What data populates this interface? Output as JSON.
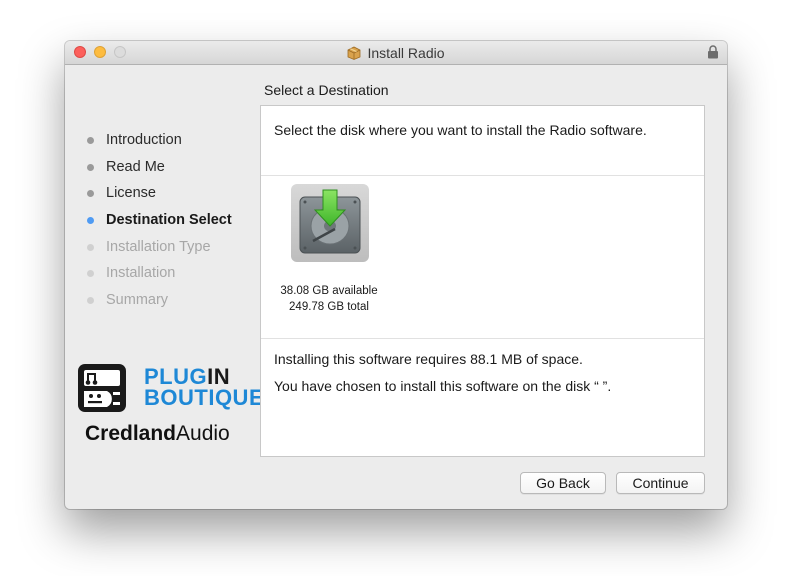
{
  "window": {
    "title": "Install Radio",
    "title_icon": "package-icon",
    "lock_icon": "lock-icon"
  },
  "steps": [
    {
      "label": "Introduction",
      "state": "done"
    },
    {
      "label": "Read Me",
      "state": "done"
    },
    {
      "label": "License",
      "state": "done"
    },
    {
      "label": "Destination Select",
      "state": "active"
    },
    {
      "label": "Installation Type",
      "state": "future"
    },
    {
      "label": "Installation",
      "state": "future"
    },
    {
      "label": "Summary",
      "state": "future"
    }
  ],
  "branding": {
    "plugin_line1_a": "PLUG",
    "plugin_line1_b": "IN",
    "plugin_line2": "BOUTIQUE",
    "credland_bold": "Credland",
    "credland_regular": "Audio"
  },
  "main": {
    "section_title": "Select a Destination",
    "instruction": "Select the disk where you want to install the Radio software.",
    "disk": {
      "available": "38.08 GB available",
      "total": "249.78 GB total",
      "icon": "hard-disk-install-icon"
    },
    "requirement": "Installing this software requires 88.1 MB of space.",
    "chosen": "You have chosen to install this software on the disk “  ”."
  },
  "buttons": {
    "go_back": "Go Back",
    "continue": "Continue"
  },
  "colors": {
    "active_step_dot": "#4f9bf3",
    "brand_blue": "#1e88d6",
    "install_arrow": "#5ed13a"
  }
}
